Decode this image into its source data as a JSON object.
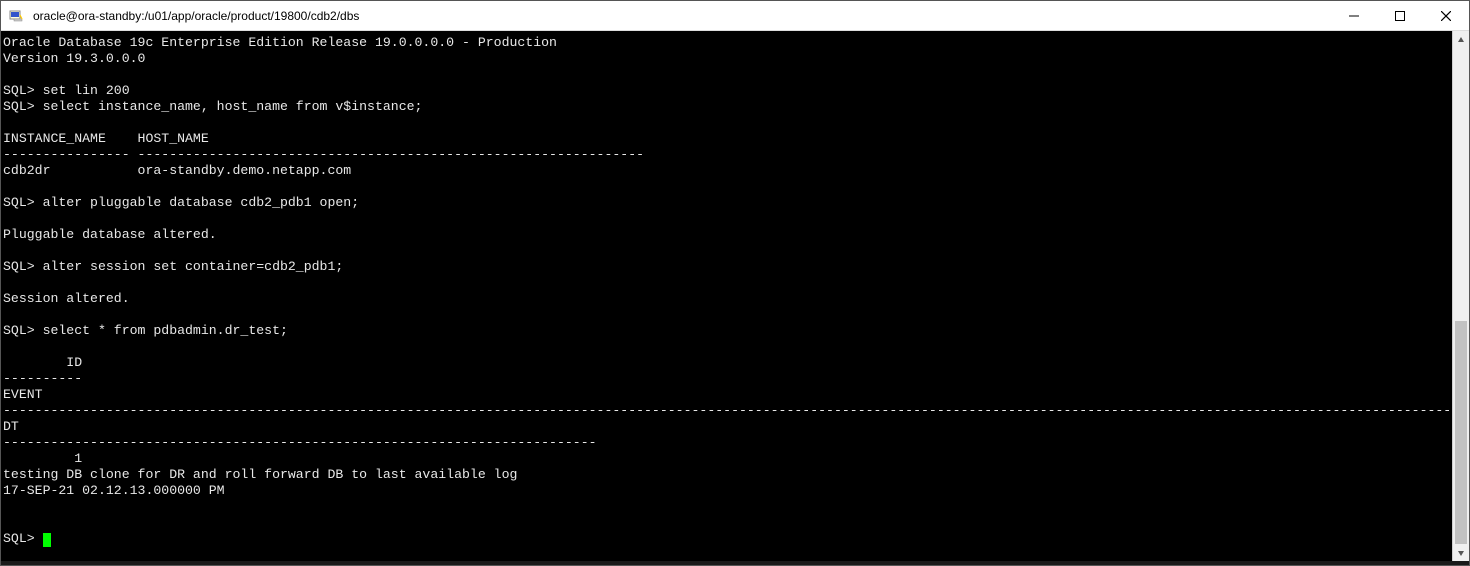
{
  "window": {
    "title": "oracle@ora-standby:/u01/app/oracle/product/19800/cdb2/dbs"
  },
  "terminal": {
    "lines": [
      "Oracle Database 19c Enterprise Edition Release 19.0.0.0.0 - Production",
      "Version 19.3.0.0.0",
      "",
      "SQL> set lin 200",
      "SQL> select instance_name, host_name from v$instance;",
      "",
      "INSTANCE_NAME    HOST_NAME",
      "---------------- ----------------------------------------------------------------",
      "cdb2dr           ora-standby.demo.netapp.com",
      "",
      "SQL> alter pluggable database cdb2_pdb1 open;",
      "",
      "Pluggable database altered.",
      "",
      "SQL> alter session set container=cdb2_pdb1;",
      "",
      "Session altered.",
      "",
      "SQL> select * from pdbadmin.dr_test;",
      "",
      "        ID",
      "----------",
      "EVENT",
      "--------------------------------------------------------------------------------------------------------------------------------------------------------------------------------------------------------",
      "DT",
      "---------------------------------------------------------------------------",
      "         1",
      "testing DB clone for DR and roll forward DB to last available log",
      "17-SEP-21 02.12.13.000000 PM",
      "",
      "",
      "SQL> "
    ]
  },
  "scrollbar": {
    "thumb_top_pct": 55,
    "thumb_height_pct": 45
  }
}
